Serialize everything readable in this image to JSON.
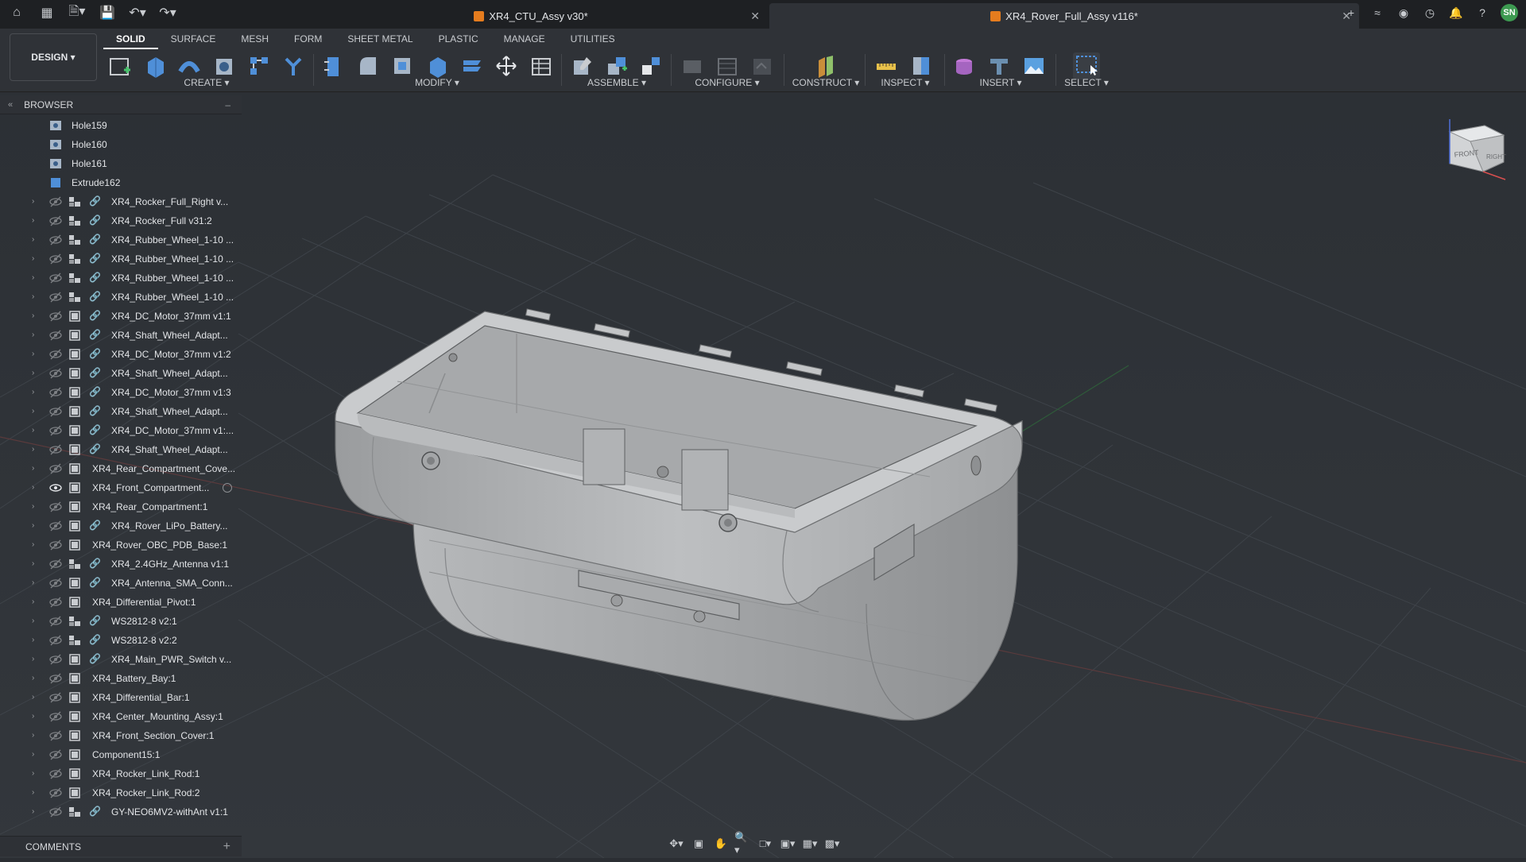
{
  "titlebar": {
    "tabs": [
      {
        "title": "XR4_CTU_Assy v30*"
      },
      {
        "title": "XR4_Rover_Full_Assy v116*"
      }
    ],
    "user_initials": "SN"
  },
  "toolbar": {
    "workspace": "DESIGN",
    "tabs": [
      "SOLID",
      "SURFACE",
      "MESH",
      "FORM",
      "SHEET METAL",
      "PLASTIC",
      "MANAGE",
      "UTILITIES"
    ],
    "groups": {
      "create": "CREATE",
      "modify": "MODIFY",
      "assemble": "ASSEMBLE",
      "configure": "CONFIGURE",
      "construct": "CONSTRUCT",
      "inspect": "INSPECT",
      "insert": "INSERT",
      "select": "SELECT"
    }
  },
  "browser": {
    "title": "BROWSER",
    "features": [
      "Hole159",
      "Hole160",
      "Hole161",
      "Extrude162"
    ],
    "components": [
      {
        "label": "XR4_Rocker_Full_Right v...",
        "linked": true,
        "assy": true
      },
      {
        "label": "XR4_Rocker_Full v31:2",
        "linked": true,
        "assy": true
      },
      {
        "label": "XR4_Rubber_Wheel_1-10 ...",
        "linked": true,
        "assy": true
      },
      {
        "label": "XR4_Rubber_Wheel_1-10 ...",
        "linked": true,
        "assy": true
      },
      {
        "label": "XR4_Rubber_Wheel_1-10 ...",
        "linked": true,
        "assy": true
      },
      {
        "label": "XR4_Rubber_Wheel_1-10 ...",
        "linked": true,
        "assy": true
      },
      {
        "label": "XR4_DC_Motor_37mm v1:1",
        "linked": true,
        "assy": false
      },
      {
        "label": "XR4_Shaft_Wheel_Adapt...",
        "linked": true,
        "assy": false
      },
      {
        "label": "XR4_DC_Motor_37mm v1:2",
        "linked": true,
        "assy": false
      },
      {
        "label": "XR4_Shaft_Wheel_Adapt...",
        "linked": true,
        "assy": false
      },
      {
        "label": "XR4_DC_Motor_37mm v1:3",
        "linked": true,
        "assy": false
      },
      {
        "label": "XR4_Shaft_Wheel_Adapt...",
        "linked": true,
        "assy": false
      },
      {
        "label": "XR4_DC_Motor_37mm v1:...",
        "linked": true,
        "assy": false
      },
      {
        "label": "XR4_Shaft_Wheel_Adapt...",
        "linked": true,
        "assy": false
      },
      {
        "label": "XR4_Rear_Compartment_Cove...",
        "linked": false,
        "assy": false
      },
      {
        "label": "XR4_Front_Compartment...",
        "linked": false,
        "assy": false,
        "visible": true,
        "radio": true
      },
      {
        "label": "XR4_Rear_Compartment:1",
        "linked": false,
        "assy": false
      },
      {
        "label": "XR4_Rover_LiPo_Battery...",
        "linked": true,
        "assy": false
      },
      {
        "label": "XR4_Rover_OBC_PDB_Base:1",
        "linked": false,
        "assy": false
      },
      {
        "label": "XR4_2.4GHz_Antenna v1:1",
        "linked": true,
        "assy": true
      },
      {
        "label": "XR4_Antenna_SMA_Conn...",
        "linked": true,
        "assy": false
      },
      {
        "label": "XR4_Differential_Pivot:1",
        "linked": false,
        "assy": false
      },
      {
        "label": "WS2812-8 v2:1",
        "linked": true,
        "assy": true
      },
      {
        "label": "WS2812-8 v2:2",
        "linked": true,
        "assy": true
      },
      {
        "label": "XR4_Main_PWR_Switch v...",
        "linked": true,
        "assy": false
      },
      {
        "label": "XR4_Battery_Bay:1",
        "linked": false,
        "assy": false
      },
      {
        "label": "XR4_Differential_Bar:1",
        "linked": false,
        "assy": false
      },
      {
        "label": "XR4_Center_Mounting_Assy:1",
        "linked": false,
        "assy": false
      },
      {
        "label": "XR4_Front_Section_Cover:1",
        "linked": false,
        "assy": false
      },
      {
        "label": "Component15:1",
        "linked": false,
        "assy": false
      },
      {
        "label": "XR4_Rocker_Link_Rod:1",
        "linked": false,
        "assy": false
      },
      {
        "label": "XR4_Rocker_Link_Rod:2",
        "linked": false,
        "assy": false
      },
      {
        "label": "GY-NEO6MV2-withAnt v1:1",
        "linked": true,
        "assy": true
      }
    ]
  },
  "comments": {
    "title": "COMMENTS"
  },
  "viewcube": {
    "front": "FRONT",
    "right": "RIGHT"
  },
  "colors": {
    "accent_orange": "#e57c1e",
    "avatar_green": "#3d9a51",
    "viewport_bg": "#2b2e33"
  }
}
